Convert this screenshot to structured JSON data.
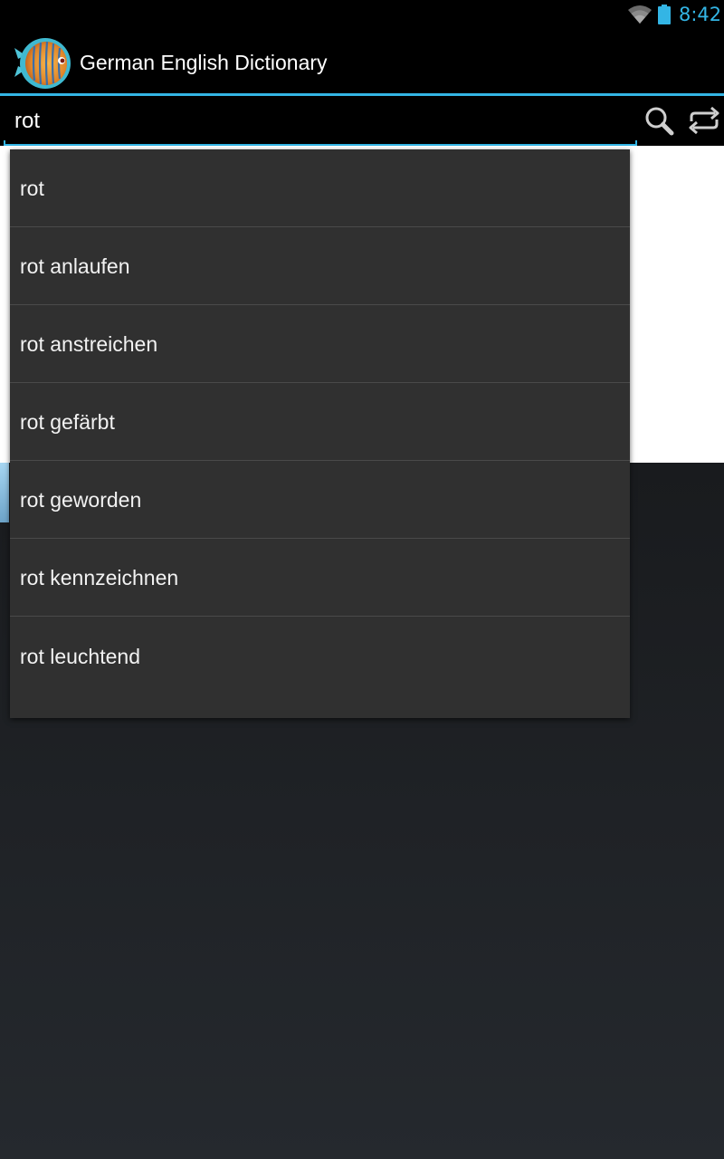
{
  "status_bar": {
    "time": "8:42",
    "wifi_icon": "wifi-icon",
    "battery_icon": "battery-icon",
    "accent_color": "#33b5e5"
  },
  "action_bar": {
    "title": "German English Dictionary",
    "app_icon": "discus-fish-icon"
  },
  "search": {
    "value": "rot",
    "search_icon": "search-icon",
    "swap_icon": "swap-languages-icon"
  },
  "suggestions": [
    "rot",
    "rot anlaufen",
    "rot anstreichen",
    "rot gefärbt",
    "rot geworden",
    "rot kennzeichnen",
    "rot leuchtend"
  ]
}
